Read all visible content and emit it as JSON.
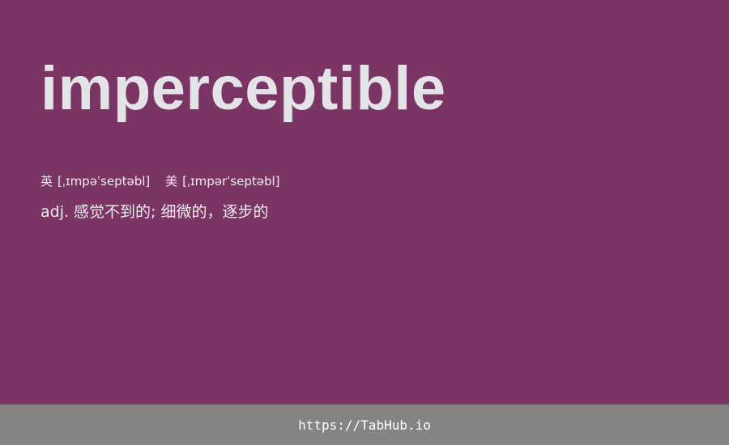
{
  "word": "imperceptible",
  "phonetics": {
    "uk": {
      "label": "英",
      "ipa": "[ˌɪmpəˈseptəbl]"
    },
    "us": {
      "label": "美",
      "ipa": "[ˌɪmpərˈseptəbl]"
    }
  },
  "definition": {
    "pos": "adj.",
    "text": "感觉不到的; 细微的，逐步的"
  },
  "footer": {
    "link": "https://TabHub.io"
  },
  "colors": {
    "background": "#7b3565",
    "footer_background": "#848484",
    "text": "#e6e6e6"
  }
}
